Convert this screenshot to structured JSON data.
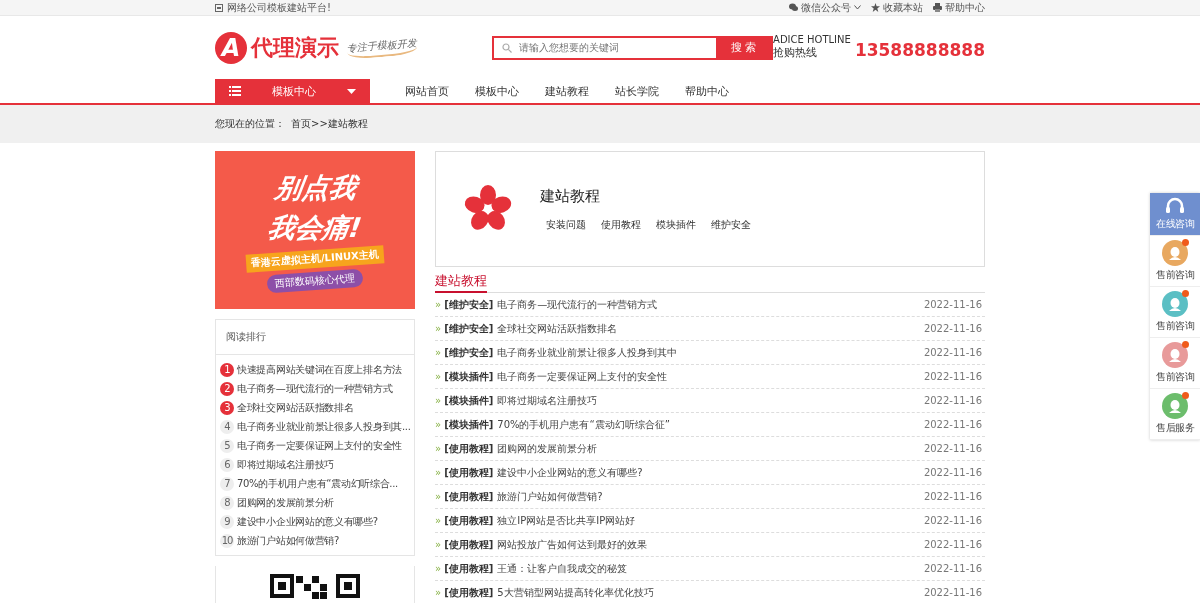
{
  "top_bar": {
    "site_note": "网络公司模板建站平台!",
    "links": [
      {
        "kind": "wechat",
        "label": "微信公众号"
      },
      {
        "kind": "star",
        "label": "收藏本站"
      },
      {
        "kind": "help",
        "label": "帮助中心"
      }
    ]
  },
  "header": {
    "logo": {
      "mark": "A",
      "name": "代理演示",
      "slogan": "专注于模板开发"
    },
    "search": {
      "placeholder": "请输入您想要的关键词",
      "button": "搜 索"
    },
    "hotline": {
      "caption": "ADICE HOTLINE",
      "label": "抢购热线",
      "number": "13588888888"
    }
  },
  "nav": {
    "category_button": "模板中心",
    "items": [
      {
        "label": "网站首页",
        "selected": false
      },
      {
        "label": "模板中心",
        "selected": false
      },
      {
        "label": "建站教程",
        "selected": false
      },
      {
        "label": "站长学院",
        "selected": false
      },
      {
        "label": "帮助中心",
        "selected": false
      }
    ]
  },
  "breadcrumb": {
    "label": "您现在的位置：",
    "path": "首页>>建站教程"
  },
  "banner": {
    "line1": "别点我",
    "line2": "我会痛!",
    "strip": "香港云虚拟主机/LINUX主机",
    "pill": "西部数码核心代理"
  },
  "ranking": {
    "title": "阅读排行",
    "items": [
      {
        "rank": "1",
        "hot": true,
        "title": "快速提高网站关键词在百度上排名方法"
      },
      {
        "rank": "2",
        "hot": true,
        "title": "电子商务—现代流行的一种营销方式"
      },
      {
        "rank": "3",
        "hot": true,
        "title": "全球社交网站活跃指数排名"
      },
      {
        "rank": "4",
        "hot": false,
        "title": "电子商务业就业前景让很多人投身到其..."
      },
      {
        "rank": "5",
        "hot": false,
        "title": "电子商务一定要保证网上支付的安全性"
      },
      {
        "rank": "6",
        "hot": false,
        "title": "即将过期域名注册技巧"
      },
      {
        "rank": "7",
        "hot": false,
        "title": "70%的手机用户患有“震动幻听综合..."
      },
      {
        "rank": "8",
        "hot": false,
        "title": "团购网的发展前景分析"
      },
      {
        "rank": "9",
        "hot": false,
        "title": "建设中小企业网站的意义有哪些?"
      },
      {
        "rank": "10",
        "hot": false,
        "title": "旅游门户站如何做营销?"
      }
    ]
  },
  "category": {
    "title": "建站教程",
    "subcategories": [
      "安装问题",
      "使用教程",
      "模块插件",
      "维护安全"
    ]
  },
  "article_list": {
    "heading": "建站教程",
    "marker": "»",
    "items": [
      {
        "tag": "[维护安全]",
        "title": "电子商务—现代流行的一种营销方式",
        "date": "2022-11-16"
      },
      {
        "tag": "[维护安全]",
        "title": "全球社交网站活跃指数排名",
        "date": "2022-11-16"
      },
      {
        "tag": "[维护安全]",
        "title": "电子商务业就业前景让很多人投身到其中",
        "date": "2022-11-16"
      },
      {
        "tag": "[模块插件]",
        "title": "电子商务一定要保证网上支付的安全性",
        "date": "2022-11-16"
      },
      {
        "tag": "[模块插件]",
        "title": "即将过期域名注册技巧",
        "date": "2022-11-16"
      },
      {
        "tag": "[模块插件]",
        "title": "70%的手机用户患有“震动幻听综合征”",
        "date": "2022-11-16"
      },
      {
        "tag": "[使用教程]",
        "title": "团购网的发展前景分析",
        "date": "2022-11-16"
      },
      {
        "tag": "[使用教程]",
        "title": "建设中小企业网站的意义有哪些?",
        "date": "2022-11-16"
      },
      {
        "tag": "[使用教程]",
        "title": "旅游门户站如何做营销?",
        "date": "2022-11-16"
      },
      {
        "tag": "[使用教程]",
        "title": "独立IP网站是否比共享IP网站好",
        "date": "2022-11-16"
      },
      {
        "tag": "[使用教程]",
        "title": "网站投放广告如何达到最好的效果",
        "date": "2022-11-16"
      },
      {
        "tag": "[使用教程]",
        "title": "王通：让客户自我成交的秘笈",
        "date": "2022-11-16"
      },
      {
        "tag": "[使用教程]",
        "title": "5大营销型网站提高转化率优化技巧",
        "date": "2022-11-16"
      }
    ]
  },
  "float_panel": [
    {
      "kind": "header",
      "label": "在线咨询"
    },
    {
      "kind": "qq",
      "label": "售前咨询",
      "color": "#e8a860"
    },
    {
      "kind": "qq",
      "label": "售前咨询",
      "color": "#5bbfc4"
    },
    {
      "kind": "qq",
      "label": "售前咨询",
      "color": "#e89a9a"
    },
    {
      "kind": "qq",
      "label": "售后服务",
      "color": "#6cbd6c"
    }
  ]
}
